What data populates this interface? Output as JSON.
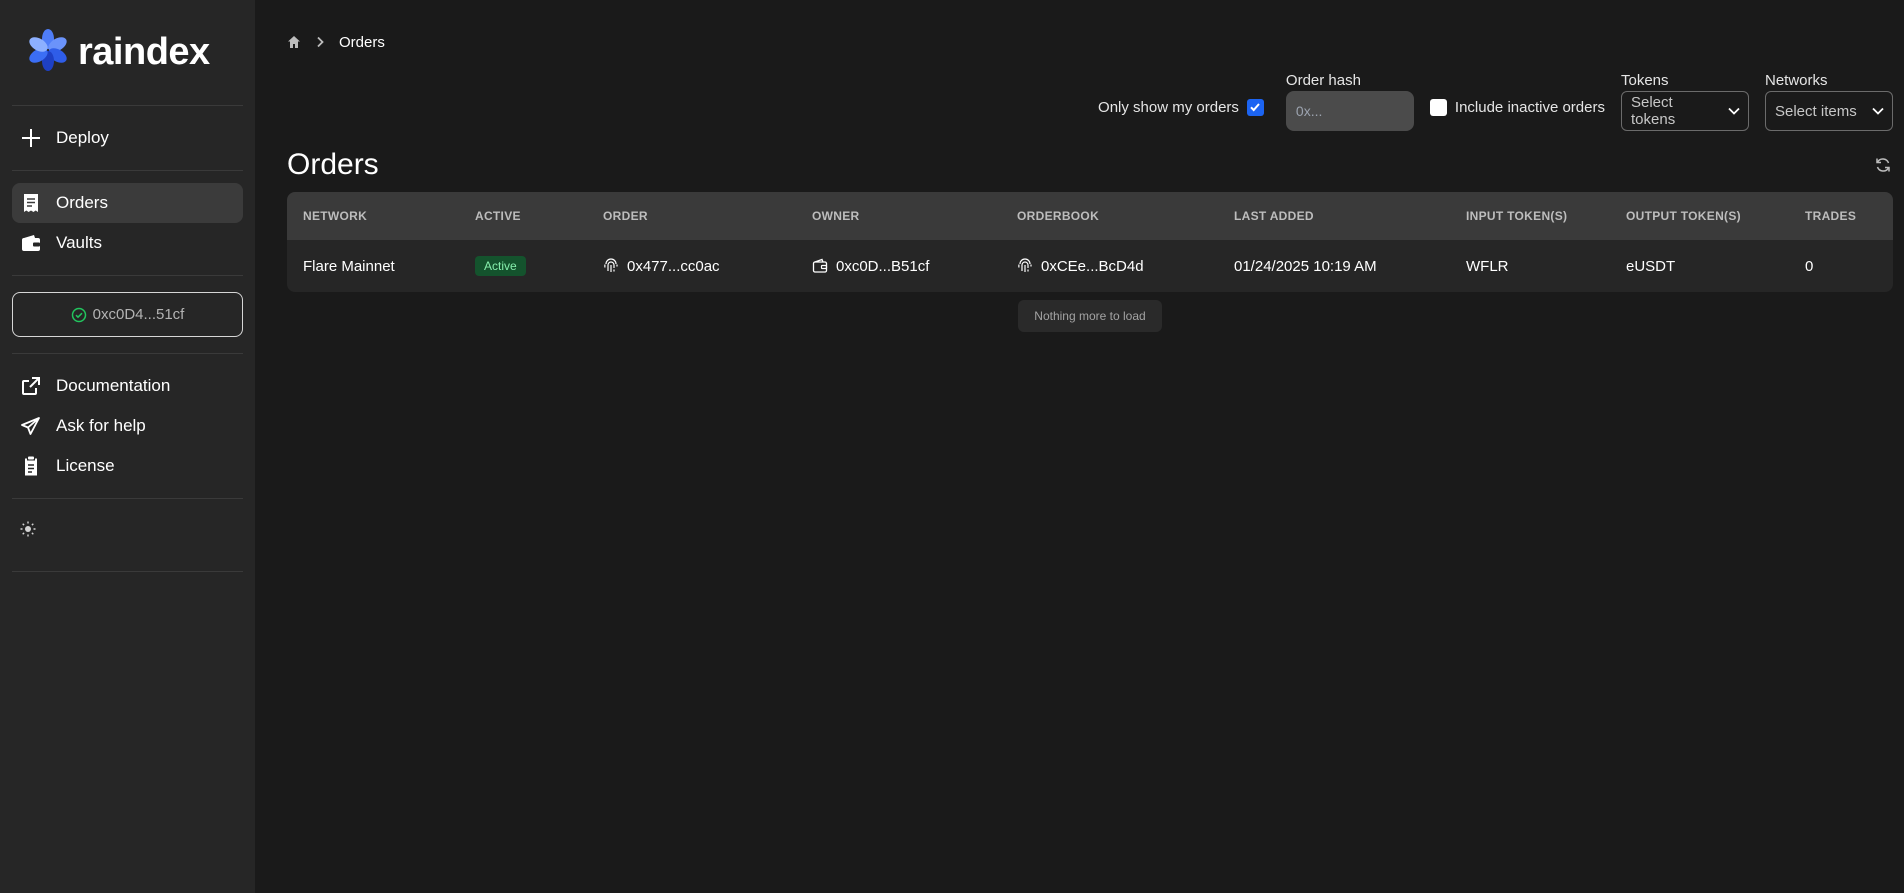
{
  "app": {
    "name": "raindex"
  },
  "sidebar": {
    "deploy_label": "Deploy",
    "items": [
      {
        "label": "Orders",
        "icon": "receipt-icon",
        "active": true
      },
      {
        "label": "Vaults",
        "icon": "wallet-icon",
        "active": false
      }
    ],
    "wallet_address": "0xc0D4...51cf",
    "links": [
      {
        "label": "Documentation",
        "icon": "external-link-icon"
      },
      {
        "label": "Ask for help",
        "icon": "paper-plane-icon"
      },
      {
        "label": "License",
        "icon": "clipboard-icon"
      }
    ],
    "theme_icon": "sun-icon"
  },
  "breadcrumb": {
    "current": "Orders"
  },
  "filters": {
    "my_orders_label": "Only show my orders",
    "my_orders_checked": true,
    "order_hash_label": "Order hash",
    "order_hash_placeholder": "0x...",
    "inactive_label": "Include inactive orders",
    "inactive_checked": false,
    "tokens_label": "Tokens",
    "tokens_placeholder": "Select tokens",
    "networks_label": "Networks",
    "networks_placeholder": "Select items"
  },
  "page": {
    "title": "Orders"
  },
  "table": {
    "headers": [
      "NETWORK",
      "ACTIVE",
      "ORDER",
      "OWNER",
      "ORDERBOOK",
      "LAST ADDED",
      "INPUT TOKEN(S)",
      "OUTPUT TOKEN(S)",
      "TRADES"
    ],
    "rows": [
      {
        "network": "Flare Mainnet",
        "active": "Active",
        "order": "0x477...cc0ac",
        "owner": "0xc0D...B51cf",
        "orderbook": "0xCEe...BcD4d",
        "last_added": "01/24/2025 10:19 AM",
        "input_tokens": "WFLR",
        "output_tokens": "eUSDT",
        "trades": "0"
      }
    ],
    "footer": "Nothing more to load"
  },
  "colors": {
    "accent": "#1c64f2",
    "active_badge_bg": "#14532d",
    "active_badge_text": "#86efac",
    "logo_blue": "#3b6ef5"
  }
}
